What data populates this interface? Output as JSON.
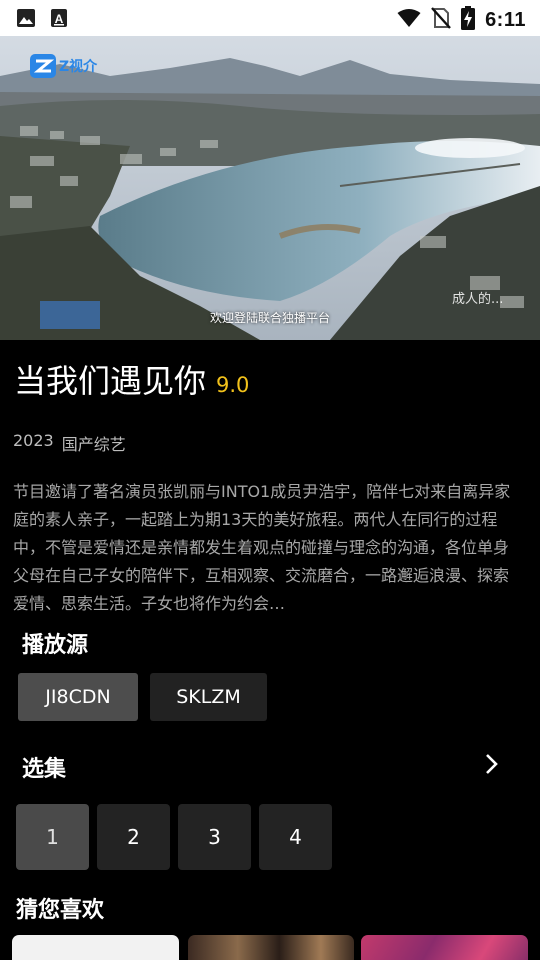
{
  "status_bar": {
    "time": "6:11",
    "left_icons": [
      "image-icon",
      "text-document-icon"
    ],
    "right_icons": [
      "wifi-icon",
      "no-sim-icon",
      "battery-charging-icon"
    ]
  },
  "video": {
    "brand": "Z视介",
    "subtitle": "欢迎登陆联合独播平台",
    "watermark": "成人的..."
  },
  "show": {
    "title": "当我们遇见你",
    "rating": "9.0",
    "year": "2023",
    "category": "国产综艺",
    "description": "节目邀请了著名演员张凯丽与INTO1成员尹浩宇，陪伴七对来自离异家庭的素人亲子，一起踏上为期13天的美好旅程。两代人在同行的过程中，不管是爱情还是亲情都发生着观点的碰撞与理念的沟通，各位单身父母在自己子女的陪伴下，互相观察、交流磨合，一路邂逅浪漫、探索爱情、思索生活。子女也将作为约会…"
  },
  "sources": {
    "heading": "播放源",
    "items": [
      {
        "label": "JI8CDN",
        "active": true
      },
      {
        "label": "SKLZM",
        "active": false
      }
    ]
  },
  "episodes": {
    "heading": "选集",
    "items": [
      {
        "label": "1",
        "active": true
      },
      {
        "label": "2",
        "active": false
      },
      {
        "label": "3",
        "active": false
      },
      {
        "label": "4",
        "active": false
      }
    ]
  },
  "recommendations": {
    "heading": "猜您喜欢"
  },
  "colors": {
    "background": "#000000",
    "rating": "#f2c21b",
    "button": "#222222",
    "button_active": "#4d4d4d",
    "brand_blue": "#2a86e6"
  }
}
